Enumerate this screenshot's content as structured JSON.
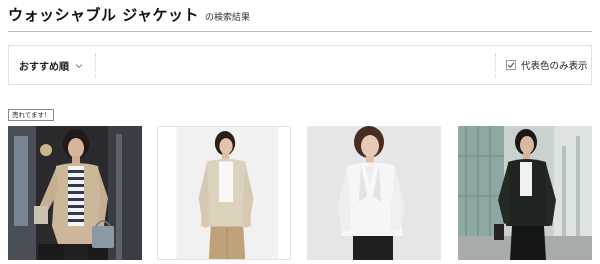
{
  "header": {
    "title": "ウォッシャブル ジャケット",
    "subtitle": "の検索結果"
  },
  "toolbar": {
    "sort_label": "おすすめ順",
    "representative_label": "代表色のみ表示",
    "representative_checked": true
  },
  "badge_label": "売れてます！",
  "products": [
    {
      "image": "model-beige-knit-cardigan-striped-top"
    },
    {
      "image": "model-beige-collarless-jacket"
    },
    {
      "image": "model-white-tailored-jacket"
    },
    {
      "image": "model-black-tailored-jacket"
    }
  ]
}
